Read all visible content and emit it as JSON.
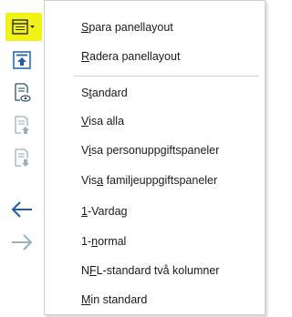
{
  "toolbar": {
    "buttons": [
      {
        "icon": "panel-layout-icon",
        "active": true,
        "highlight_color": "#f2f214"
      },
      {
        "icon": "arrow-up-to-line-icon"
      },
      {
        "icon": "document-eye-icon"
      },
      {
        "icon": "document-up-icon"
      },
      {
        "icon": "document-down-icon"
      },
      {
        "icon": "arrow-left-icon"
      },
      {
        "icon": "arrow-right-icon"
      }
    ]
  },
  "menu": {
    "items": [
      {
        "label": "Spara panellayout",
        "mnemonic_index": 0
      },
      {
        "label": "Radera panellayout",
        "mnemonic_index": 0
      },
      {
        "label": "Standard",
        "mnemonic_index": 1
      },
      {
        "label": "Visa alla",
        "mnemonic_index": 0
      },
      {
        "label": "Visa personuppgiftspaneler",
        "mnemonic_index": 1
      },
      {
        "label": "Visa familjeuppgiftspaneler",
        "mnemonic_index": 3
      },
      {
        "label": "1-Vardag",
        "mnemonic_index": 0
      },
      {
        "label": "1-normal",
        "mnemonic_index": 2
      },
      {
        "label": "NFL-standard två kolumner",
        "mnemonic_index": 1
      },
      {
        "label": "Min standard",
        "mnemonic_index": 0
      }
    ]
  },
  "colors": {
    "icon_blue": "#1f5fa8",
    "icon_gray": "#8aa0b4",
    "highlight": "#f2f214"
  }
}
